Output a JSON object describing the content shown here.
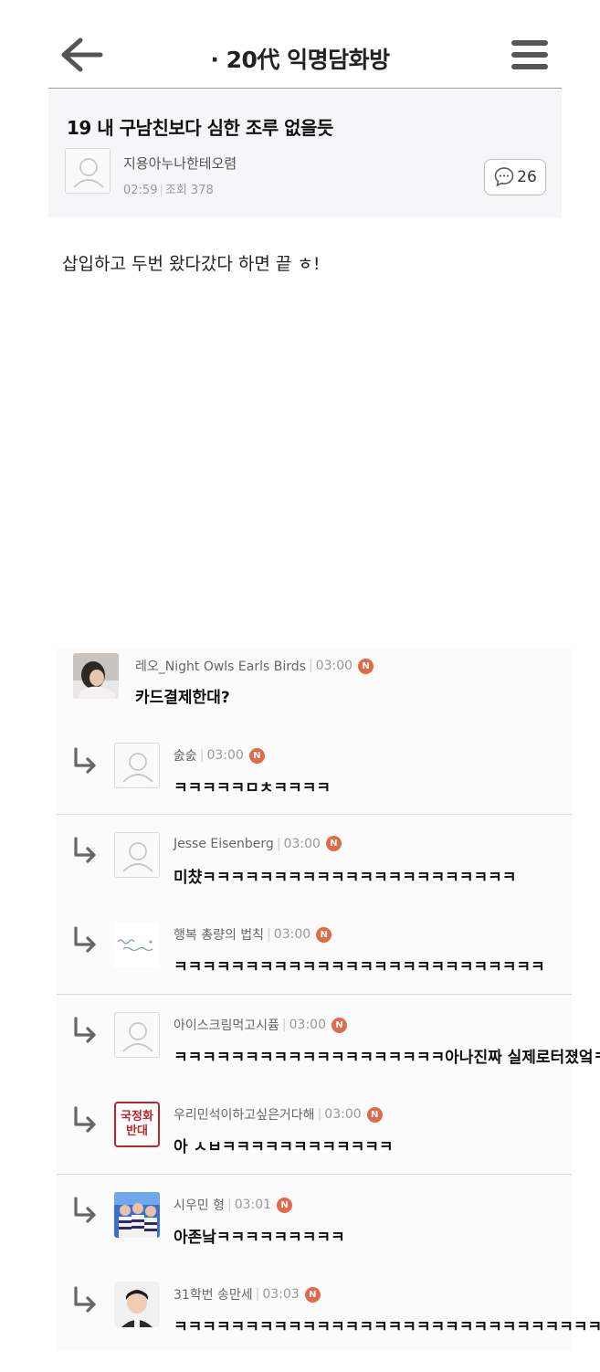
{
  "header": {
    "title": "· 20代 익명담화방"
  },
  "post": {
    "title": "19 내 구남친보다 심한 조루 없을듯",
    "author": "지용아누나한테오렴",
    "time": "02:59",
    "views": "조회 378",
    "comment_count": "26",
    "body": "삽입하고 두번 왔다갔다 하면 끝 ㅎ!"
  },
  "comments": [
    {
      "name": "레오_Night Owls Earls Birds",
      "time": "03:00",
      "badge": "N",
      "text": "카드결제한대?",
      "avatar": "photo-woman-icon"
    },
    {
      "name": "숤숤",
      "time": "03:00",
      "badge": "N",
      "text": "ㅋㅋㅋㅋㅋㅁㅊㅋㅋㅋㅋ",
      "avatar": "default-user-icon"
    },
    {
      "name": "Jesse Eisenberg",
      "time": "03:00",
      "badge": "N",
      "text": "미챴ㅋㅋㅋㅋㅋㅋㅋㅋㅋㅋㅋㅋㅋㅋㅋㅋㅋㅋㅋㅋㅋㅋ",
      "avatar": "default-user-icon"
    },
    {
      "name": "행복 총량의 법칙",
      "time": "03:00",
      "badge": "N",
      "text": "ㅋㅋㅋㅋㅋㅋㅋㅋㅋㅋㅋㅋㅋㅋㅋㅋㅋㅋㅋㅋㅋㅋㅋㅋㅋㅋ",
      "avatar": "handwriting-logo-icon"
    },
    {
      "name": "아이스크림먹고시퓸",
      "time": "03:00",
      "badge": "N",
      "text": "ㅋㅋㅋㅋㅋㅋㅋㅋㅋㅋㅋㅋㅋㅋㅋㅋㅋㅋㅋ아나진짜 실제로터졌엌ㅋ",
      "avatar": "default-user-icon"
    },
    {
      "name": "우리민석이하고싶은거다해",
      "time": "03:00",
      "badge": "N",
      "text": "아 ㅅㅂㅋㅋㅋㅋㅋㅋㅋㅋㅋㅋㅋㅋ",
      "avatar": "stamp-icon",
      "stamp_text": [
        "국정화",
        "반대"
      ]
    },
    {
      "name": "시우민 형",
      "time": "03:01",
      "badge": "N",
      "text": "아존낰ㅋㅋㅋㅋㅋㅋㅋㅋㅋ",
      "avatar": "photo-group-icon"
    },
    {
      "name": "31학번 송만세",
      "time": "03:03",
      "badge": "N",
      "text": "ㅋㅋㅋㅋㅋㅋㅋㅋㅋㅋㅋㅋㅋㅋㅋㅋㅋㅋㅋㅋㅋㅋㅋㅋㅋㅋㅋㅋㅋㅋ",
      "avatar": "photo-child-icon"
    }
  ],
  "colors": {
    "new_badge": "#e06b4b",
    "stamp_red": "#c0252a",
    "post_header_bg": "#f6f6f8"
  }
}
